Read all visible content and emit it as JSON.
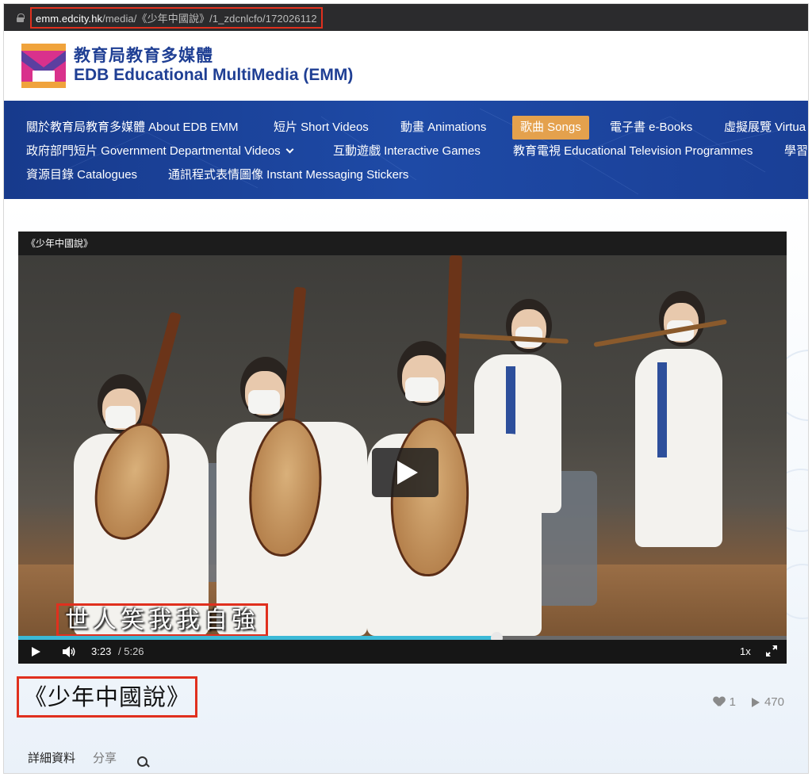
{
  "browser": {
    "url_host": "emm.edcity.hk",
    "url_path": "/media/《少年中國說》/1_zdcnlcfo/172026112"
  },
  "site": {
    "name_zh": "教育局教育多媒體",
    "name_en": "EDB Educational MultiMedia (EMM)",
    "brand_colors": {
      "navy": "#1f3f94",
      "magenta": "#d9318c",
      "orange": "#f0a33c",
      "purple": "#5b3fa0"
    }
  },
  "nav": {
    "items": [
      {
        "label": "關於教育局教育多媒體 About EDB EMM",
        "active": false
      },
      {
        "label": "短片 Short Videos",
        "active": false
      },
      {
        "label": "動畫 Animations",
        "active": false
      },
      {
        "label": "歌曲 Songs",
        "active": true
      },
      {
        "label": "電子書 e-Books",
        "active": false
      },
      {
        "label": "虛擬展覽 Virtua",
        "active": false
      },
      {
        "label": "政府部門短片 Government Departmental Videos",
        "active": false,
        "has_dropdown": true
      },
      {
        "label": "互動遊戲 Interactive Games",
        "active": false
      },
      {
        "label": "教育電視 Educational Television Programmes",
        "active": false
      },
      {
        "label": "學習",
        "active": false
      },
      {
        "label": "資源目錄 Catalogues",
        "active": false
      },
      {
        "label": "通訊程式表情圖像 Instant Messaging Stickers",
        "active": false
      }
    ],
    "active_color": "#e4a14d"
  },
  "player": {
    "title": "《少年中國說》",
    "subtitle": "世人笑我我自強",
    "current_time": "3:23",
    "duration": "/ 5:26",
    "progress": 0.622,
    "speed": "1x",
    "progress_color": "#3bb9d6"
  },
  "media": {
    "title": "《少年中國說》",
    "likes": "1",
    "plays": "470"
  },
  "tabs": [
    {
      "label": "詳細資料",
      "active": true
    },
    {
      "label": "分享",
      "active": false
    }
  ]
}
